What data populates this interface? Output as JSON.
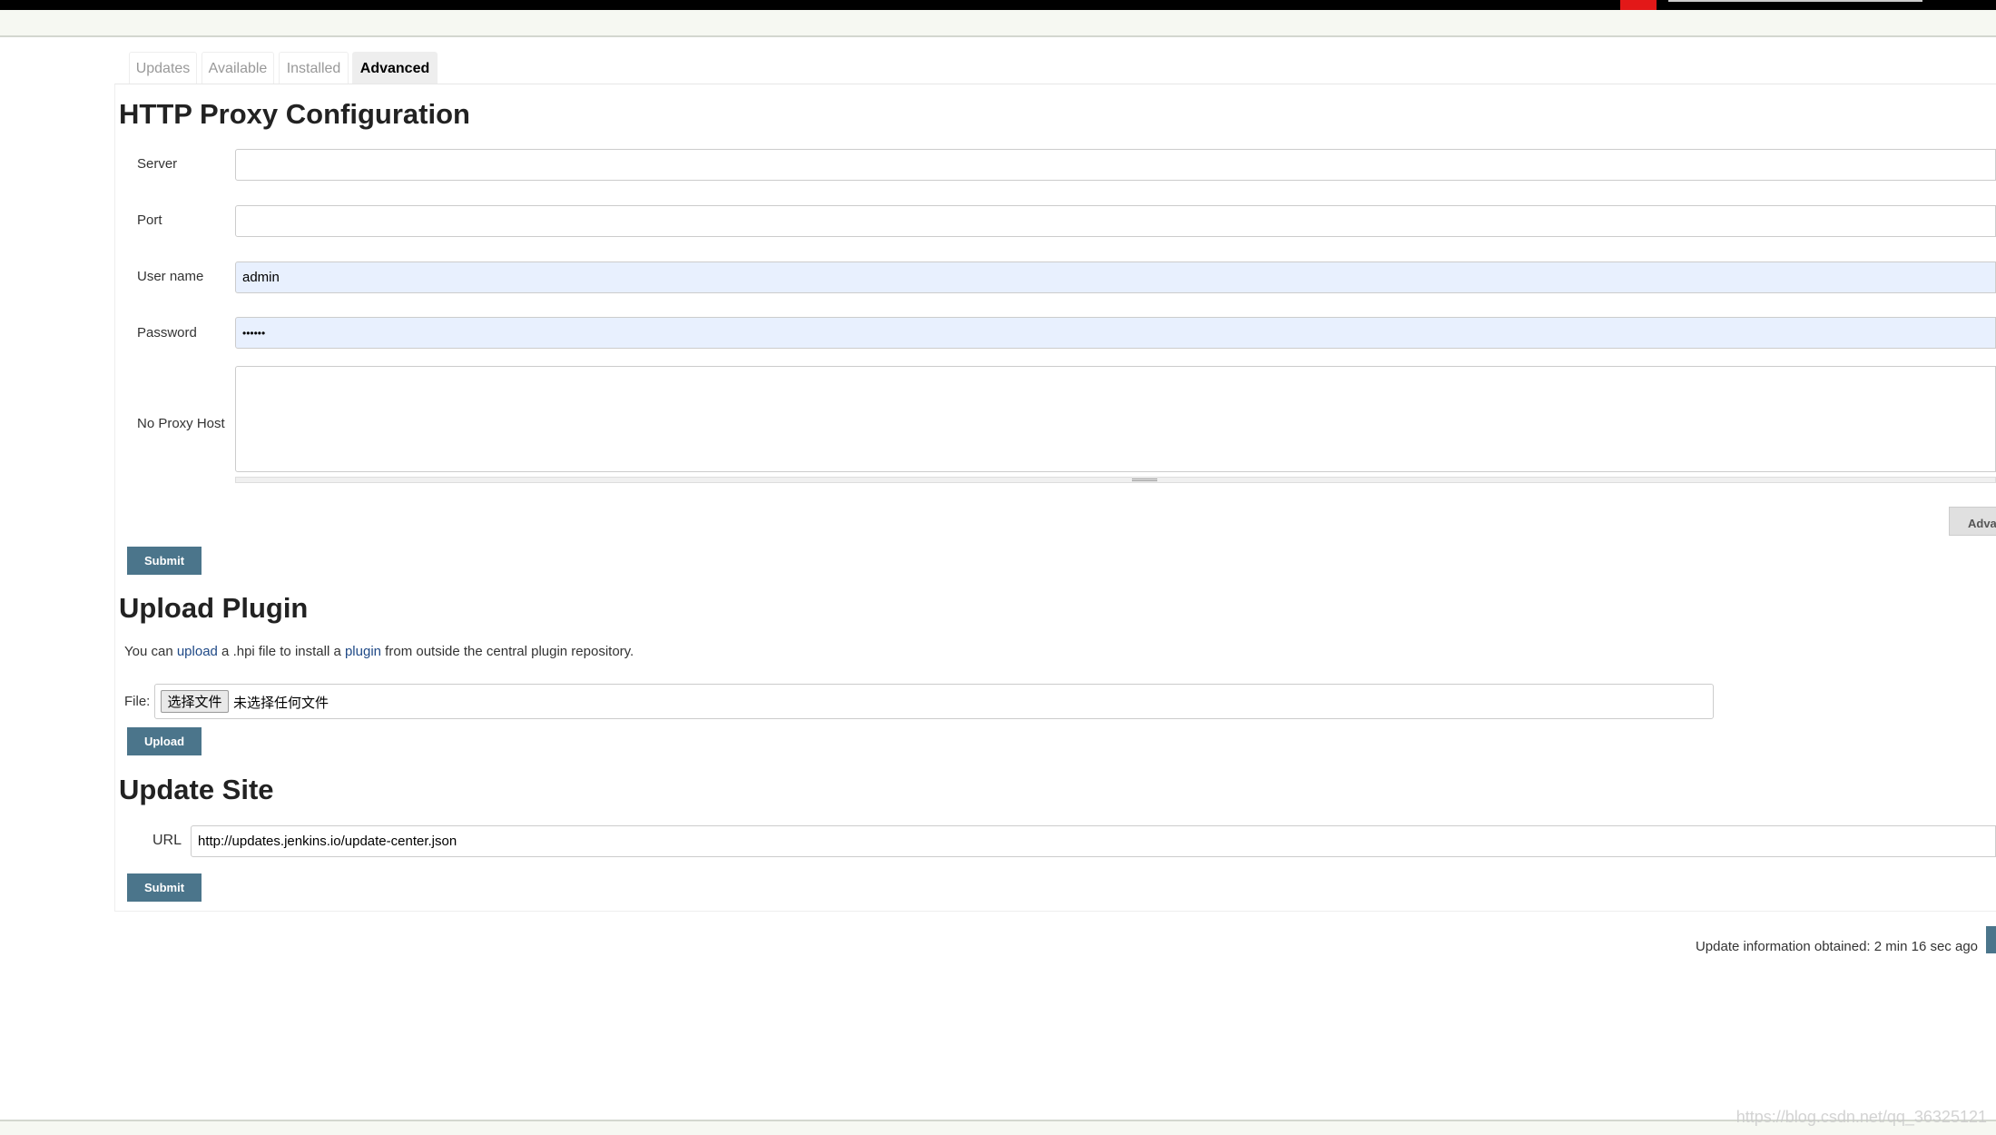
{
  "tabs": [
    {
      "label": "Updates"
    },
    {
      "label": "Available"
    },
    {
      "label": "Installed"
    },
    {
      "label": "Advanced",
      "active": true
    }
  ],
  "proxy": {
    "title": "HTTP Proxy Configuration",
    "server_label": "Server",
    "server_value": "",
    "port_label": "Port",
    "port_value": "",
    "username_label": "User name",
    "username_value": "admin",
    "password_label": "Password",
    "password_value": "••••••",
    "noproxy_label": "No Proxy Host",
    "noproxy_value": "",
    "advanced_label": "Advanced...",
    "submit_label": "Submit"
  },
  "upload": {
    "title": "Upload Plugin",
    "desc_1": "You can ",
    "link_upload": "upload",
    "desc_2": " a .hpi file to install a ",
    "link_plugin": "plugin",
    "desc_3": " from outside the central plugin repository.",
    "file_label": "File:",
    "choose_file_label": "选择文件",
    "no_file_text": "未选择任何文件",
    "upload_label": "Upload"
  },
  "update_site": {
    "title": "Update Site",
    "url_label": "URL",
    "url_value": "http://updates.jenkins.io/update-center.json",
    "submit_label": "Submit"
  },
  "footer": {
    "update_info": "Update information obtained: 2 min 16 sec ago"
  },
  "watermark": "https://blog.csdn.net/qq_36325121",
  "colors": {
    "button": "#4b758b",
    "autofill": "#e8f0fe",
    "topbar": "#000000",
    "red_block": "#e31818"
  }
}
